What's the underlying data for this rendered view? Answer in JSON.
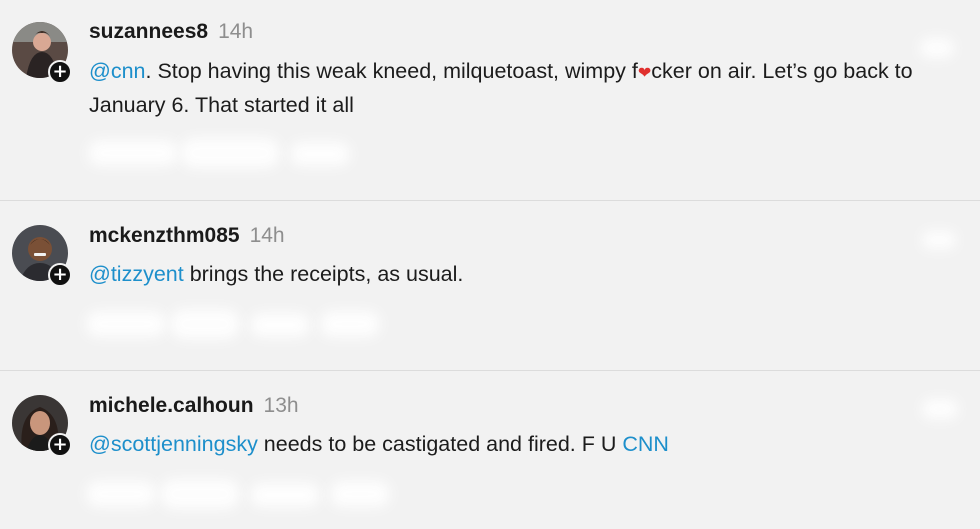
{
  "comments": [
    {
      "username": "suzannees8",
      "time": "14h",
      "segments": [
        {
          "text": "@cnn",
          "kind": "mention"
        },
        {
          "text": ". Stop having this weak kneed, milquetoast, wimpy f",
          "kind": "text"
        },
        {
          "text": "❤",
          "kind": "emoji"
        },
        {
          "text": "cker on air. Let’s go back to January 6. That started it all",
          "kind": "text"
        }
      ]
    },
    {
      "username": "mckenzthm085",
      "time": "14h",
      "segments": [
        {
          "text": "@tizzyent",
          "kind": "mention"
        },
        {
          "text": " brings the receipts, as usual.",
          "kind": "text"
        }
      ]
    },
    {
      "username": "michele.calhoun",
      "time": "13h",
      "segments": [
        {
          "text": "@scottjenningsky",
          "kind": "mention"
        },
        {
          "text": " needs to be castigated and fired. F U ",
          "kind": "text"
        },
        {
          "text": "CNN",
          "kind": "link"
        }
      ]
    }
  ],
  "follow_glyph": "+",
  "colors": {
    "background": "#f2f2f2",
    "mention": "#1d8fcb",
    "timestamp": "#8e8e8e",
    "heart": "#e0302e"
  }
}
